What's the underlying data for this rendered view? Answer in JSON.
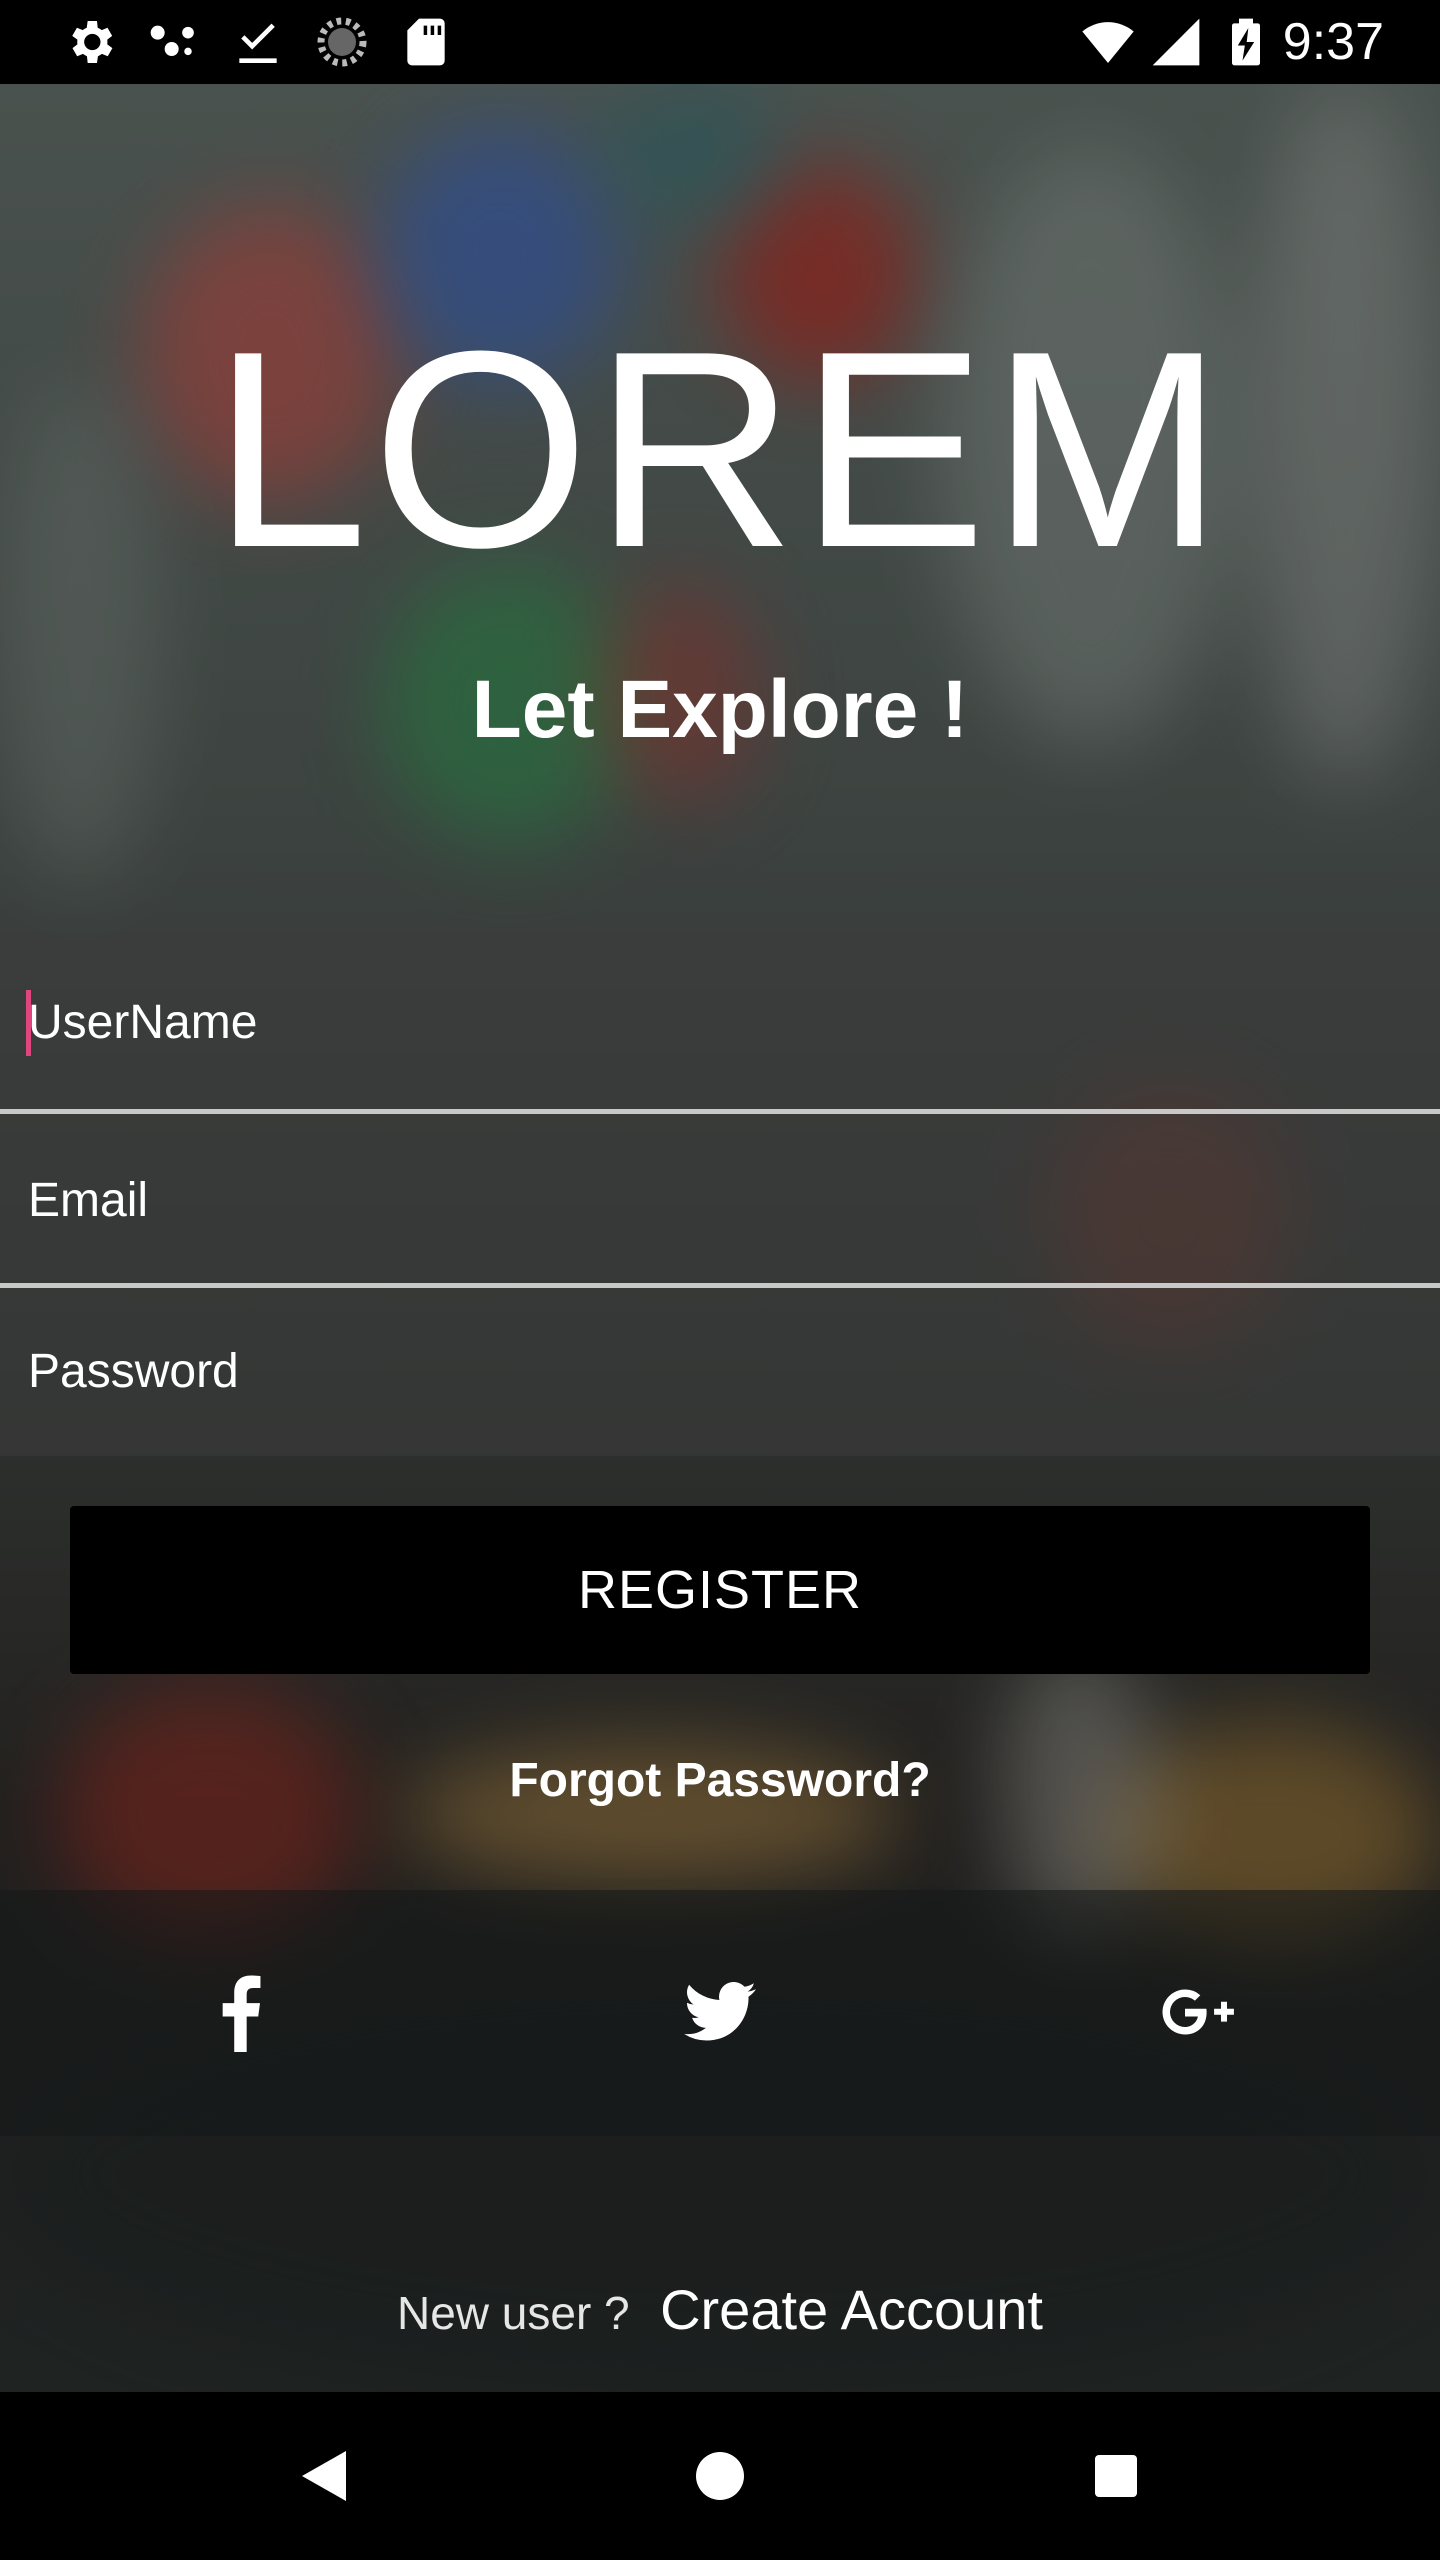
{
  "status_bar": {
    "time": "9:37",
    "left_icons": [
      "settings-icon",
      "assistant-dots-icon",
      "download-done-icon",
      "sync-progress-icon",
      "sd-card-icon"
    ],
    "right_icons": [
      "wifi-icon",
      "cell-signal-icon",
      "battery-charging-icon"
    ]
  },
  "header": {
    "logo": "LOREM",
    "tagline": "Let Explore !"
  },
  "form": {
    "username_placeholder": "UserName",
    "email_placeholder": "Email",
    "password_placeholder": "Password",
    "register_label": "REGISTER",
    "forgot_label": "Forgot Password?",
    "cursor_color": "#e0457b"
  },
  "social": {
    "icons": [
      "facebook-icon",
      "twitter-icon",
      "google-plus-icon"
    ]
  },
  "footer": {
    "new_user_text": "New user ?",
    "create_account_label": "Create Account"
  },
  "nav_bar": {
    "icons": [
      "back-icon",
      "home-icon",
      "recents-icon"
    ]
  },
  "colors": {
    "status_bar_bg": "#000000",
    "button_bg": "#000000",
    "text": "#ffffff"
  }
}
